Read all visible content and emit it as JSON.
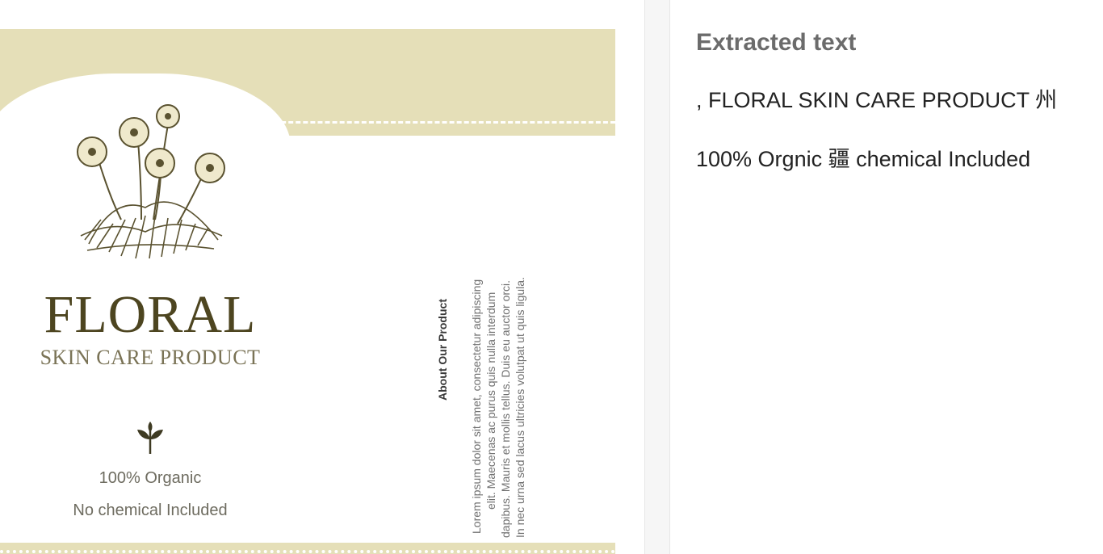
{
  "preview": {
    "brand_title": "FLORAL",
    "brand_subtitle": "SKIN CARE PRODUCT",
    "tagline_1": "100% Organic",
    "tagline_2": "No chemical Included",
    "about_title": "About Our Product",
    "about_lines": [
      "Lorem ipsum dolor sit amet, consectetur adipiscing",
      "elit. Maecenas ac purus quis nulla interdum",
      "dapibus. Mauris et mollis tellus. Duis eu auctor orci.",
      "In nec urna sed lacus ultricies volutpat ut quis ligula."
    ],
    "colors": {
      "band": "#e5dfb8",
      "brand": "#4d4520"
    },
    "icons": [
      "flower-illustration",
      "sprout-icon"
    ]
  },
  "panel": {
    "heading": "Extracted text",
    "lines": [
      ", FLORAL SKIN CARE PRODUCT 州",
      "100% Orgnic 疆 chemical Included"
    ]
  }
}
